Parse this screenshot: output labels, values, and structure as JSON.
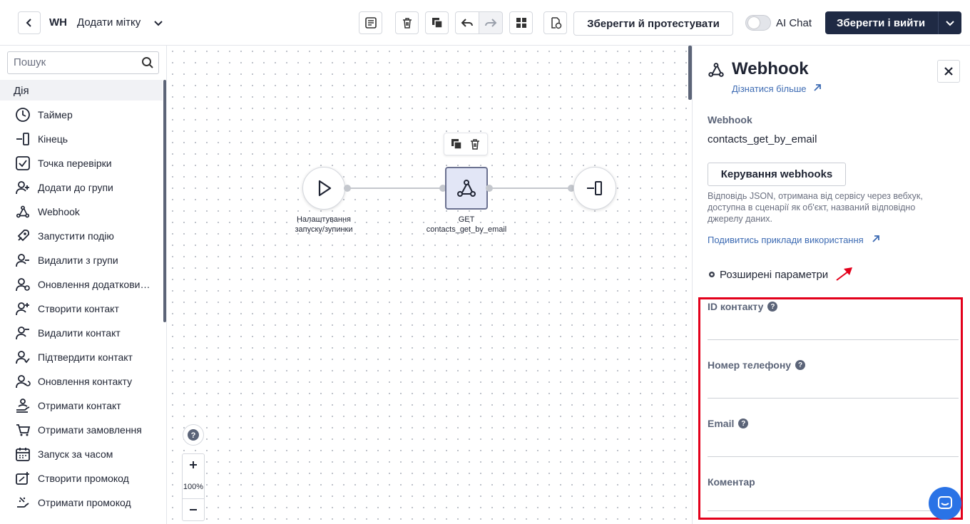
{
  "header": {
    "title_abbr": "WH",
    "title": "Додати мітку",
    "save_test_label": "Зберегти й протестувати",
    "ai_chat_label": "AI Chat",
    "save_exit_label": "Зберегти і вийти"
  },
  "sidebar": {
    "search_placeholder": "Пошук",
    "section": "Дія",
    "items": [
      {
        "label": "Таймер",
        "icon": "clock-icon"
      },
      {
        "label": "Кінець",
        "icon": "end-icon"
      },
      {
        "label": "Точка перевірки",
        "icon": "checkpoint-icon"
      },
      {
        "label": "Додати до групи",
        "icon": "add-group-icon"
      },
      {
        "label": "Webhook",
        "icon": "webhook-icon"
      },
      {
        "label": "Запустити подію",
        "icon": "rocket-icon"
      },
      {
        "label": "Видалити з групи",
        "icon": "remove-group-icon"
      },
      {
        "label": "Оновлення додаткови…",
        "icon": "update-extra-icon"
      },
      {
        "label": "Створити контакт",
        "icon": "add-contact-icon"
      },
      {
        "label": "Видалити контакт",
        "icon": "remove-contact-icon"
      },
      {
        "label": "Підтвердити контакт",
        "icon": "confirm-contact-icon"
      },
      {
        "label": "Оновлення контакту",
        "icon": "update-contact-icon"
      },
      {
        "label": "Отримати контакт",
        "icon": "get-contact-icon"
      },
      {
        "label": "Отримати замовлення",
        "icon": "cart-icon"
      },
      {
        "label": "Запуск за часом",
        "icon": "calendar-icon"
      },
      {
        "label": "Створити промокод",
        "icon": "create-promo-icon"
      },
      {
        "label": "Отримати промокод",
        "icon": "get-promo-icon"
      }
    ]
  },
  "canvas": {
    "start_label_1": "Налаштування",
    "start_label_2": "запуску/зупинки",
    "webhook_method": "GET",
    "webhook_name": "contacts_get_by_email",
    "zoom": "100%"
  },
  "panel": {
    "title": "Webhook",
    "learn_more": "Дізнатися більше",
    "webhook_label": "Webhook",
    "webhook_value": "contacts_get_by_email",
    "manage_button": "Керування webhooks",
    "description": "Відповідь JSON, отримана від сервісу через вебхук, доступна в сценарії як об'єкт, названий відповідно джерелу даних.",
    "examples_link": "Подивитись приклади використання",
    "advanced": "Розширені параметри",
    "fields": [
      {
        "label": "ID контакту",
        "help": true
      },
      {
        "label": "Номер телефону",
        "help": true
      },
      {
        "label": "Email",
        "help": true
      },
      {
        "label": "Коментар",
        "help": false
      }
    ]
  },
  "colors": {
    "primary_dark": "#1f2a44",
    "link": "#3d6bb3",
    "highlight": "#e3001b",
    "chat_bubble": "#2a73e6"
  }
}
